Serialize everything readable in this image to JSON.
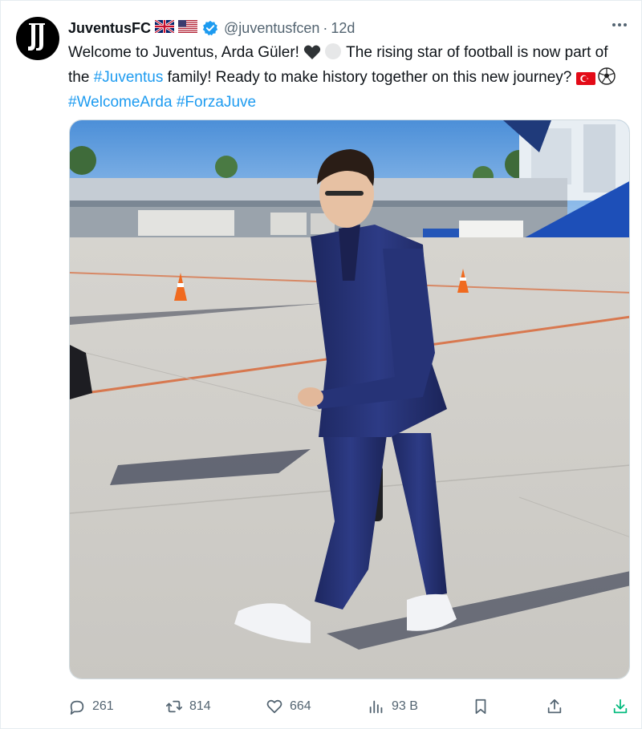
{
  "tweet": {
    "display_name": "JuventusFC",
    "handle": "@juventusfcen",
    "separator": "·",
    "time": "12d",
    "text_parts": {
      "p1": "Welcome to Juventus, Arda Güler! ",
      "p2": " The rising star of football is now part of the ",
      "hashtag_juventus": "#Juventus",
      "p3": " family! Ready to make history together on this new journey? ",
      "hashtag_welcome": "#WelcomeArda",
      "hashtag_forza": "#ForzaJuve"
    },
    "emojis": [
      "black-heart",
      "white-circle",
      "turkey-flag",
      "soccer-ball"
    ],
    "flags": [
      "uk-flag",
      "us-flag"
    ]
  },
  "actions": {
    "replies": "261",
    "reposts": "814",
    "likes": "664",
    "views": "93 B"
  },
  "icons": [
    "juventus-logo-icon",
    "verified-badge-icon",
    "more-icon",
    "reply-icon",
    "repost-icon",
    "like-icon",
    "views-icon",
    "bookmark-icon",
    "share-icon",
    "download-icon"
  ],
  "colors": {
    "link": "#1d9bf0",
    "muted": "#536471",
    "verified": "#1d9bf0",
    "download_accent": "#00ba7c",
    "suit": "#24306e"
  }
}
